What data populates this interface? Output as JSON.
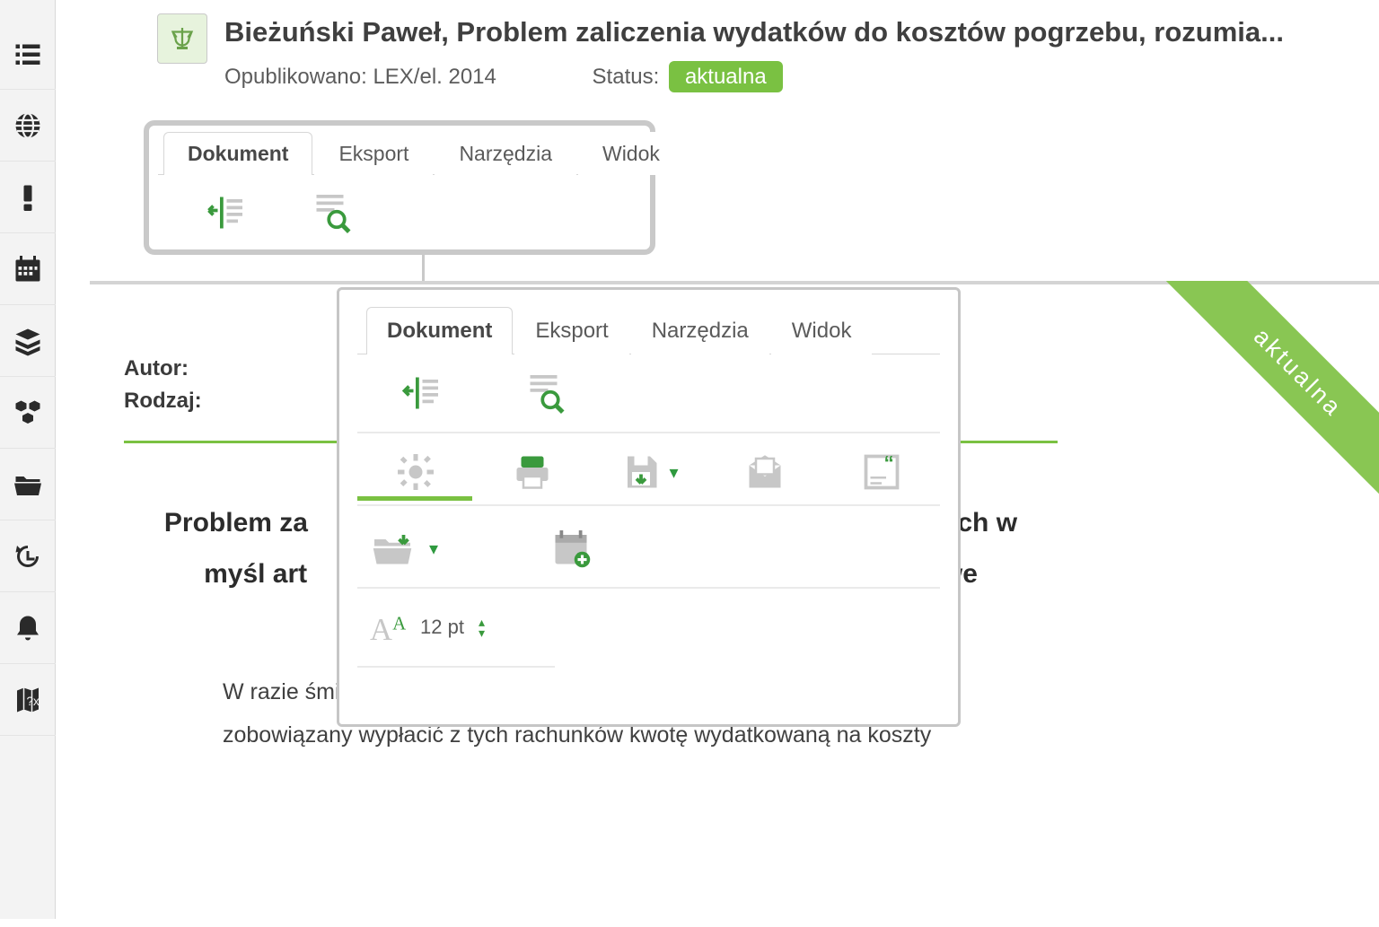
{
  "sidebar": {
    "items": [
      {
        "name": "list"
      },
      {
        "name": "globe"
      },
      {
        "name": "exclaim"
      },
      {
        "name": "calendar"
      },
      {
        "name": "stack"
      },
      {
        "name": "modules"
      },
      {
        "name": "folder"
      },
      {
        "name": "history"
      },
      {
        "name": "bell"
      },
      {
        "name": "map"
      }
    ]
  },
  "header": {
    "title": "Bieżuński Paweł, Problem zaliczenia wydatków do kosztów pogrzebu, rozumia...",
    "published_label": "Opublikowano:",
    "published_value": "LEX/el. 2014",
    "status_label": "Status:",
    "status_value": "aktualna"
  },
  "ribbon": {
    "tabs": [
      "Dokument",
      "Eksport",
      "Narzędzia",
      "Widok"
    ],
    "active_index": 0
  },
  "popup": {
    "tabs": [
      "Dokument",
      "Eksport",
      "Narzędzia",
      "Widok"
    ],
    "active_index": 0,
    "font_size": "12 pt"
  },
  "document": {
    "meta": {
      "author_label": "Autor:",
      "kind_label": "Rodzaj:"
    },
    "title_line1_left": "Problem za",
    "title_line1_right": "mianych w",
    "title_line2_left": "myśl art",
    "title_line2_right": "ankowe",
    "body": "W razie śmierci posiadacza rachunków oszczędnościowych bank jest zobowiązany wypłacić z tych rachunków kwotę wydatkowaną na koszty"
  },
  "corner_ribbon": "aktualna"
}
